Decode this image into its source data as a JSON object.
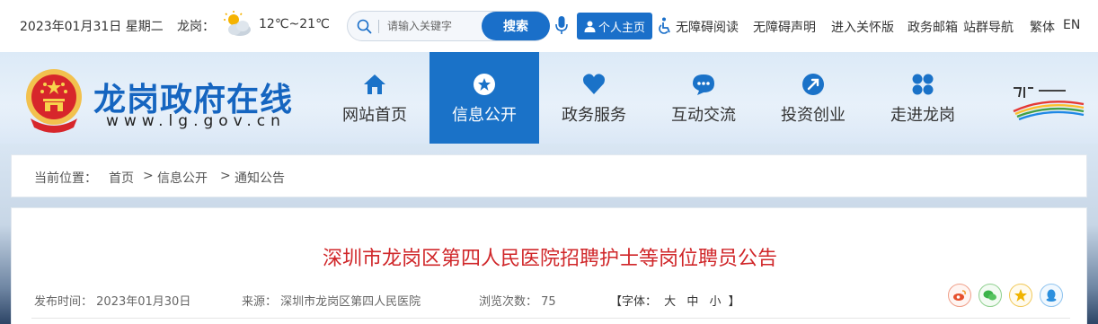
{
  "topbar": {
    "date": "2023年01月31日 星期二",
    "city_label": "龙岗：",
    "temperature": "12℃~21℃",
    "weather_icon": "cloud-sun-icon",
    "search_placeholder": "请输入关键字",
    "search_button": "搜索",
    "personal_button": "个人主页",
    "links": [
      "无障碍阅读",
      "无障碍声明",
      "进入关怀版",
      "政务邮箱",
      "站群导航",
      "繁体",
      "EN"
    ]
  },
  "header": {
    "site_title": "龙岗政府在线",
    "site_url": "www.lg.gov.cn",
    "nav": [
      {
        "label": "网站首页",
        "icon": "home-icon"
      },
      {
        "label": "信息公开",
        "icon": "star-icon"
      },
      {
        "label": "政务服务",
        "icon": "heart-icon"
      },
      {
        "label": "互动交流",
        "icon": "chat-icon"
      },
      {
        "label": "投资创业",
        "icon": "rocket-icon"
      },
      {
        "label": "走进龙岗",
        "icon": "grid-icon"
      }
    ],
    "active_nav": "信息公开",
    "brand_colors": {
      "primary": "#1a72c8",
      "title_red": "#d0272a"
    }
  },
  "breadcrumb": {
    "label": "当前位置：",
    "items": [
      "首页",
      "信息公开",
      "通知公告"
    ],
    "separator": ">"
  },
  "article": {
    "title": "深圳市龙岗区第四人民医院招聘护士等岗位聘员公告",
    "publish_label": "发布时间：",
    "publish_date": "2023年01月30日",
    "source_label": "来源：",
    "source": "深圳市龙岗区第四人民医院",
    "views_label": "浏览次数：",
    "views": "75",
    "font_label": "【字体：",
    "font_sizes": [
      "大",
      "中",
      "小"
    ],
    "font_close": "】",
    "share_icons": [
      "weibo-icon",
      "wechat-icon",
      "favorite-icon",
      "qq-icon"
    ]
  }
}
